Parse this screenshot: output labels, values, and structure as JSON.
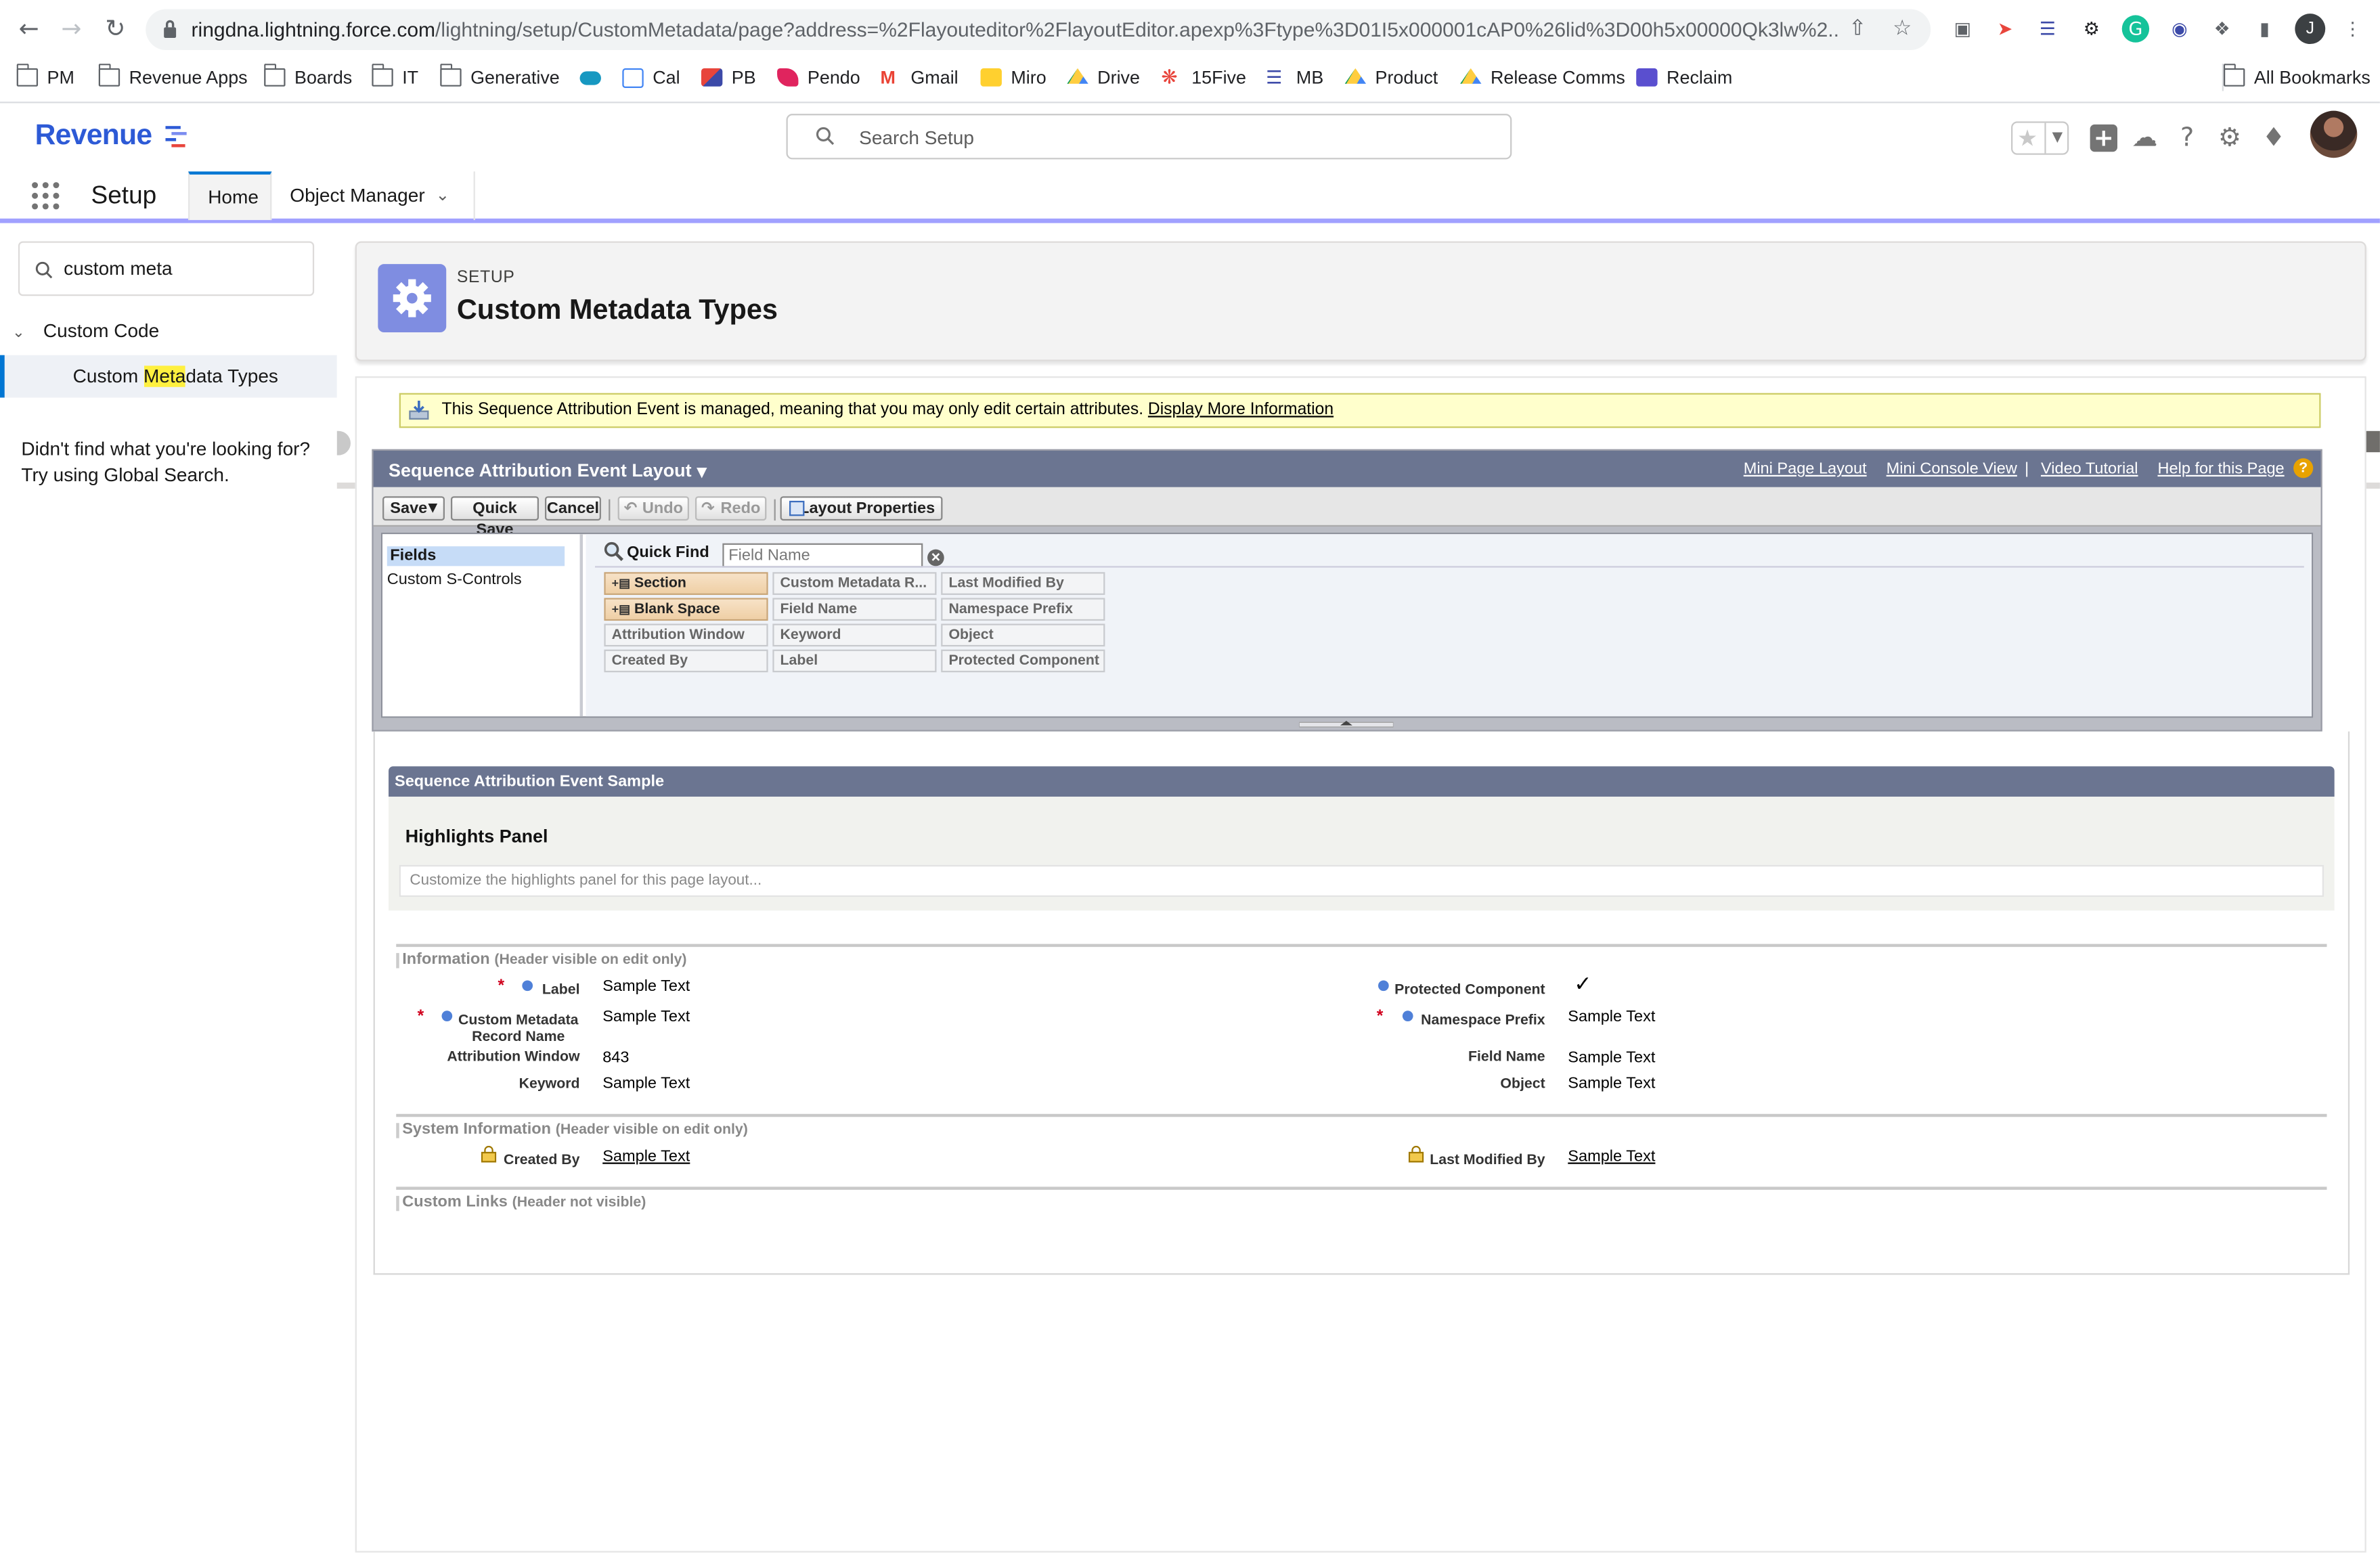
{
  "browser": {
    "url_host": "ringdna.lightning.force.com",
    "url_path": "/lightning/setup/CustomMetadata/page?address=%2Flayouteditor%2FlayoutEditor.apexp%3Ftype%3D01I5x000001cAP0%26lid%3D00h5x00000Qk3lw%2...",
    "profile_initial": "J",
    "bookmarks": [
      "PM",
      "Revenue Apps",
      "Boards",
      "IT",
      "Generative",
      "",
      "Cal",
      "PB",
      "Pendo",
      "Gmail",
      "Miro",
      "Drive",
      "15Five",
      "MB",
      "Product",
      "Release Comms",
      "Reclaim"
    ],
    "all_bookmarks": "All Bookmarks"
  },
  "header": {
    "logo": "Revenue",
    "search_placeholder": "Search Setup"
  },
  "nav": {
    "app_name": "Setup",
    "tabs": [
      "Home",
      "Object Manager"
    ]
  },
  "sidebar": {
    "quick_find_value": "custom meta",
    "group": "Custom Code",
    "item_prefix": "Custom ",
    "item_highlight": "Meta",
    "item_suffix": "data Types",
    "not_found": "Didn't find what you're looking for? Try using Global Search."
  },
  "page_header": {
    "breadcrumb": "SETUP",
    "title": "Custom Metadata Types"
  },
  "managed_notice": {
    "text": "This Sequence Attribution Event is managed, meaning that you may only edit certain attributes.",
    "link": "Display More Information"
  },
  "editor": {
    "title": "Sequence Attribution Event Layout",
    "links": [
      "Mini Page Layout",
      "Mini Console View",
      "Video Tutorial",
      "Help for this Page"
    ],
    "help_glyph": "?",
    "toolbar": {
      "save": "Save",
      "quick_save": "Quick Save",
      "cancel": "Cancel",
      "undo": "Undo",
      "redo": "Redo",
      "layout_properties": "Layout Properties"
    },
    "palette_categories": [
      "Fields",
      "Custom S-Controls"
    ],
    "quick_find_label": "Quick Find",
    "quick_find_placeholder": "Field Name",
    "palette_items": [
      [
        "Section",
        "Custom Metadata R...",
        "Last Modified By"
      ],
      [
        "Blank Space",
        "Field Name",
        "Namespace Prefix"
      ],
      [
        "Attribution Window",
        "Keyword",
        "Object"
      ],
      [
        "Created By",
        "Label",
        "Protected Component"
      ]
    ]
  },
  "layout": {
    "sample_title": "Sequence Attribution Event Sample",
    "highlights_title": "Highlights Panel",
    "highlights_hint": "Customize the highlights panel for this page layout...",
    "sections": [
      {
        "name": "Information",
        "note": "(Header visible on edit only)"
      },
      {
        "name": "System Information",
        "note": "(Header visible on edit only)"
      },
      {
        "name": "Custom Links",
        "note": "(Header not visible)"
      }
    ],
    "info_left": [
      {
        "label": "Label",
        "value": "Sample Text"
      },
      {
        "label": "Custom Metadata Record Name",
        "value": "Sample Text"
      },
      {
        "label": "Attribution Window",
        "value": "843"
      },
      {
        "label": "Keyword",
        "value": "Sample Text"
      }
    ],
    "info_right": [
      {
        "label": "Protected Component",
        "value": "✓"
      },
      {
        "label": "Namespace Prefix",
        "value": "Sample Text"
      },
      {
        "label": "Field Name",
        "value": "Sample Text"
      },
      {
        "label": "Object",
        "value": "Sample Text"
      }
    ],
    "system_left": {
      "label": "Created By",
      "value": "Sample Text"
    },
    "system_right": {
      "label": "Last Modified By",
      "value": "Sample Text"
    }
  }
}
